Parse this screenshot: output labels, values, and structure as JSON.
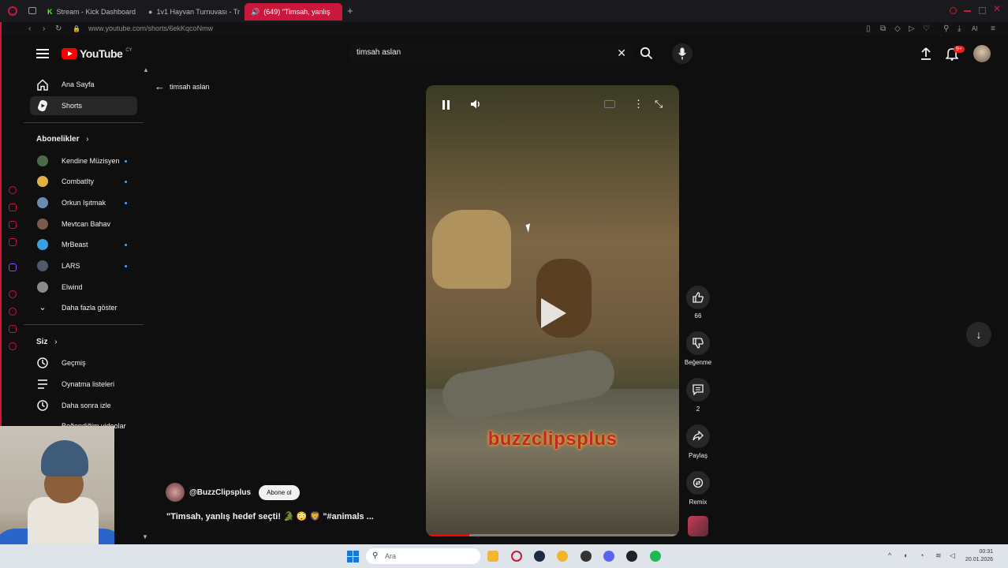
{
  "browser": {
    "tabs": [
      {
        "label": "Stream - Kick Dashboard",
        "active": false
      },
      {
        "label": "1v1 Hayvan Turnuvası - Tr",
        "active": false
      },
      {
        "label": "(649) \"Timsah, yanlış",
        "active": true
      }
    ],
    "url": "www.youtube.com/shorts/6ekKqcoNmw",
    "accent": "#c9183b"
  },
  "youtube": {
    "logo_text": "YouTube",
    "country_code": "CY",
    "search": {
      "value": "timsah aslan"
    },
    "notification_count": "9+"
  },
  "sidebar": {
    "main": [
      {
        "label": "Ana Sayfa",
        "icon": "home-icon",
        "active": false
      },
      {
        "label": "Shorts",
        "icon": "shorts-icon",
        "active": true
      }
    ],
    "subscriptions_header": "Abonelikler",
    "subscriptions": [
      {
        "label": "Kendine Müzisyen",
        "new": true,
        "color": "#4a6b4a"
      },
      {
        "label": "CombatIty",
        "new": true,
        "color": "#e0b040"
      },
      {
        "label": "Orkun Işıtmak",
        "new": true,
        "color": "#6a8ab0"
      },
      {
        "label": "Mevtcan Bahav",
        "new": false,
        "color": "#7a5a4a"
      },
      {
        "label": "MrBeast",
        "new": true,
        "color": "#3aa0e0"
      },
      {
        "label": "LARS",
        "new": true,
        "color": "#505a6a"
      },
      {
        "label": "Elwind",
        "new": false,
        "color": "#8a8a8a"
      }
    ],
    "show_more": "Daha fazla göster",
    "you_header": "Siz",
    "you_items": [
      {
        "label": "Geçmiş",
        "icon": "history-icon"
      },
      {
        "label": "Oynatma listeleri",
        "icon": "playlists-icon"
      },
      {
        "label": "Daha sonra izle",
        "icon": "watch-later-icon"
      },
      {
        "label": "Beğendiğim videolar",
        "icon": "liked-icon"
      }
    ]
  },
  "back": {
    "query": "timsah aslan"
  },
  "video": {
    "watermark": "buzzclipsplus",
    "progress_fraction": 0.17
  },
  "actions": {
    "likes": "66",
    "dislike_label": "Beğenme",
    "comments": "2",
    "share_label": "Paylaş",
    "remix_label": "Remix"
  },
  "channel": {
    "name": "@BuzzClipsplus",
    "subscribe_label": "Abone ol",
    "title": "\"Timsah, yanlış hedef seçti! 🐊 😳 🦁 \"#animals ..."
  },
  "taskbar": {
    "search_placeholder": "Ara",
    "time": "00:31",
    "date": "20.01.2026"
  }
}
